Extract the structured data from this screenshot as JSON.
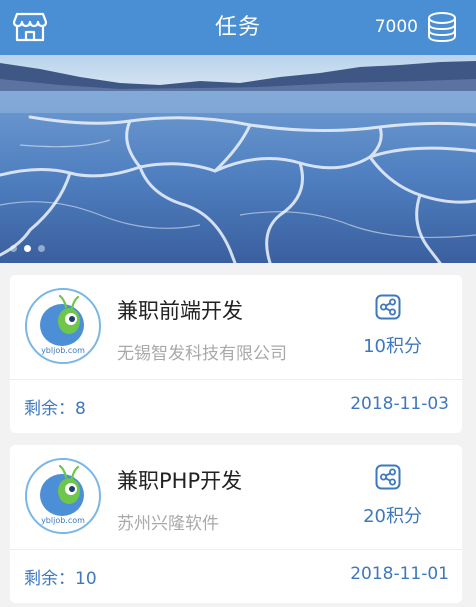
{
  "header": {
    "title": "任务",
    "points": "7000"
  },
  "banner": {
    "slide_count": 3,
    "active_slide": 2
  },
  "tasks": [
    {
      "title": "兼职前端开发",
      "company": "无锡智发科技有限公司",
      "reward": "10积分",
      "remaining": "剩余：8",
      "date": "2018-11-03",
      "logo_text": "ybljob.com"
    },
    {
      "title": "兼职PHP开发",
      "company": "苏州兴隆软件",
      "reward": "20积分",
      "remaining": "剩余：10",
      "date": "2018-11-01",
      "logo_text": "ybljob.com"
    }
  ],
  "colors": {
    "header_bg": "#4a8fd3",
    "accent": "#3d78bf",
    "muted_text": "#a9a9a9"
  },
  "icons": {
    "header_left": "store-icon",
    "header_right": "coins-stack-icon",
    "card_action": "share-icon"
  }
}
